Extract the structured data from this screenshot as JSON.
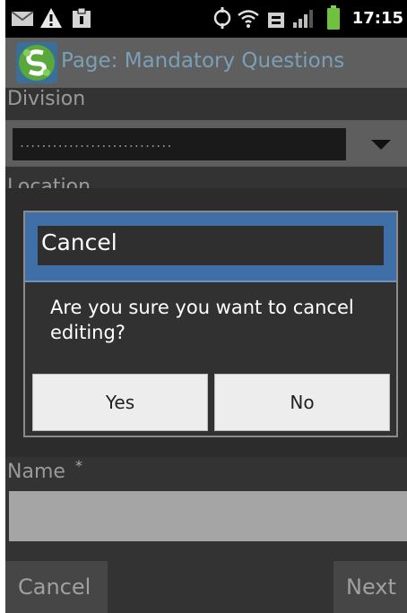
{
  "status_bar": {
    "time": "17:15",
    "icons": [
      "email-icon",
      "warning-icon",
      "clipboard-icon",
      "sync-icon",
      "wifi-icon",
      "data-icon",
      "signal-icon",
      "battery-icon"
    ]
  },
  "title_bar": {
    "title": "Page: Mandatory Questions",
    "logo_icon": "app-logo-icon"
  },
  "form": {
    "division_label": "Division",
    "division_value": "............................",
    "location_label": "Location",
    "name_label": "Name",
    "name_required_marker": "*",
    "name_value": ""
  },
  "dialog": {
    "title": "Cancel",
    "message": "Are you sure you want to cancel editing?",
    "yes_label": "Yes",
    "no_label": "No"
  },
  "footer": {
    "cancel_label": "Cancel",
    "next_label": "Next"
  },
  "colors": {
    "dialog_header": "#3f6fa6",
    "title_text": "#7aa0b8",
    "logo_green": "#5aa83c"
  }
}
